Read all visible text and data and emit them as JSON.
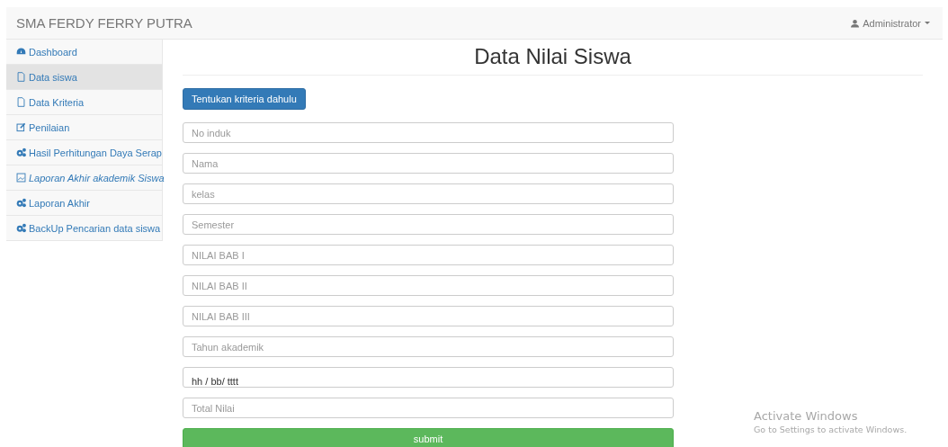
{
  "navbar": {
    "brand": "SMA FERDY FERRY PUTRA",
    "user": "Administrator"
  },
  "sidebar": {
    "items": [
      {
        "label": "Dashboard",
        "kind": "dashboard",
        "selected": false
      },
      {
        "label": "Data siswa",
        "kind": "file",
        "selected": true
      },
      {
        "label": "Data Kriteria",
        "kind": "file",
        "selected": false
      },
      {
        "label": "Penilaian",
        "kind": "edit",
        "selected": false
      },
      {
        "label": "Hasil Perhitungan Daya Serap",
        "kind": "process",
        "selected": false
      },
      {
        "label": "Laporan Akhir akademik Siswa",
        "kind": "report",
        "selected": false
      },
      {
        "label": "Laporan Akhir",
        "kind": "process",
        "selected": false
      },
      {
        "label": "BackUp Pencarian data siswa",
        "kind": "process",
        "selected": false
      }
    ]
  },
  "page_title": "Data Nilai Siswa",
  "criteria_button": "Tentukan kriteria dahulu",
  "fields": [
    {
      "placeholder": "No induk"
    },
    {
      "placeholder": "Nama"
    },
    {
      "placeholder": "kelas"
    },
    {
      "placeholder": "Semester"
    },
    {
      "placeholder": "NILAI BAB I"
    },
    {
      "placeholder": "NILAI BAB II"
    },
    {
      "placeholder": "NILAI BAB III"
    },
    {
      "placeholder": "Tahun akademik"
    },
    {
      "value": "hh / bb/ tttt"
    },
    {
      "placeholder": "Total Nilai"
    }
  ],
  "submit_button": "submit",
  "os_notice": {
    "title": "Activate Windows",
    "message": "Go to Settings to activate Windows."
  }
}
